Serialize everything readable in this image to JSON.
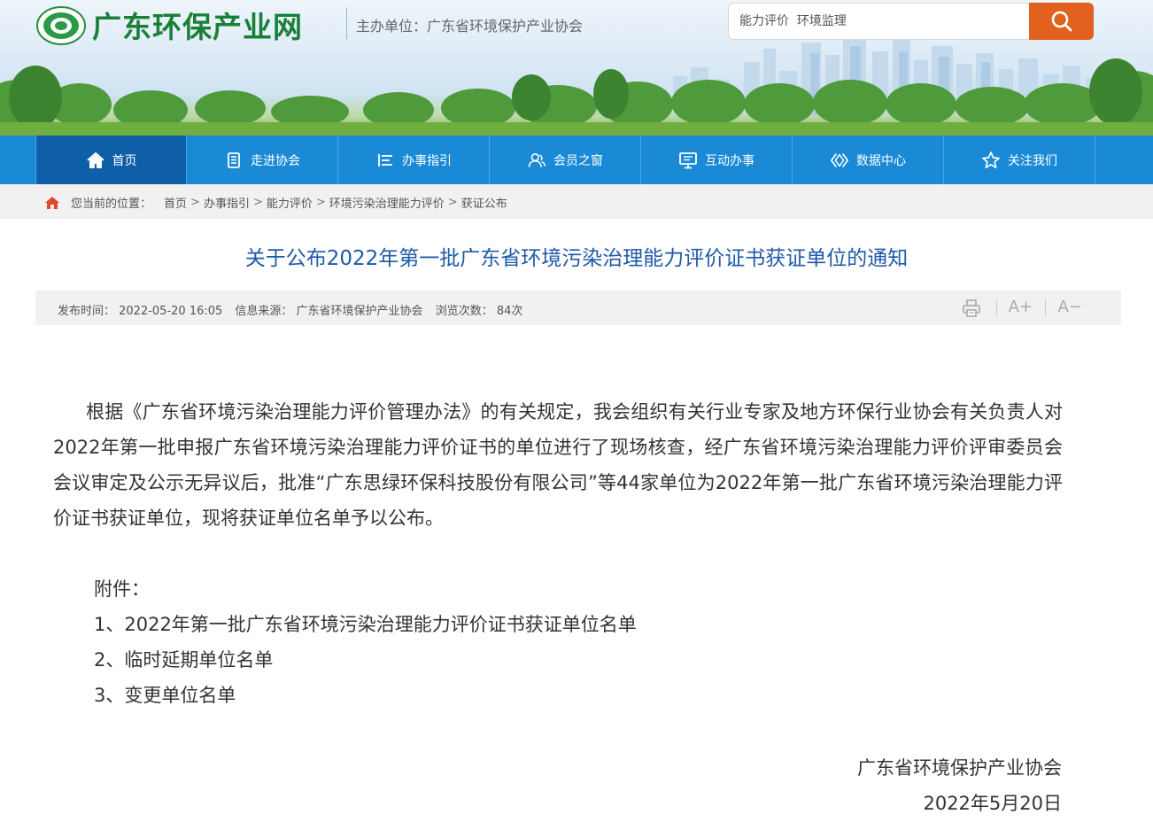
{
  "header": {
    "site_name": "广东环保产业网",
    "sponsor": "主办单位：广东省环境保护产业协会",
    "search_placeholder": "能力评价  环境监理"
  },
  "nav": {
    "items": [
      {
        "label": "首页",
        "icon": "home-icon",
        "active": true
      },
      {
        "label": "走进协会",
        "icon": "document-icon"
      },
      {
        "label": "办事指引",
        "icon": "list-icon"
      },
      {
        "label": "会员之窗",
        "icon": "members-icon"
      },
      {
        "label": "互动办事",
        "icon": "monitor-icon"
      },
      {
        "label": "数据中心",
        "icon": "data-icon"
      },
      {
        "label": "关注我们",
        "icon": "star-icon"
      }
    ]
  },
  "breadcrumb": {
    "lead": "您当前的位置：",
    "items": [
      "首页",
      "办事指引",
      "能力评价",
      "环境污染治理能力评价",
      "获证公布"
    ],
    "separator": ">"
  },
  "article": {
    "title": "关于公布2022年第一批广东省环境污染治理能力评价证书获证单位的通知",
    "meta": {
      "publish_time": "发布时间：  2022-05-20 16:05",
      "source": "信息来源：  广东省环境保护产业协会",
      "views": "浏览次数：  84次"
    },
    "tools": {
      "print_icon": "printer-icon",
      "font_up": "A+",
      "font_down": "A−"
    },
    "body": "根据《广东省环境污染治理能力评价管理办法》的有关规定，我会组织有关行业专家及地方环保行业协会有关负责人对2022年第一批申报广东省环境污染治理能力评价证书的单位进行了现场核查，经广东省环境污染治理能力评价评审委员会会议审定及公示无异议后，批准“广东思绿环保科技股份有限公司”等44家单位为2022年第一批广东省环境污染治理能力评价证书获证单位，现将获证单位名单予以公布。",
    "attachments_label": "附件：",
    "attachments": [
      "1、2022年第一批广东省环境污染治理能力评价证书获证单位名单",
      "2、临时延期单位名单",
      "3、变更单位名单"
    ],
    "signature": "广东省环境保护产业协会",
    "date": "2022年5月20日"
  },
  "colors": {
    "nav": "#1a8ad6",
    "nav_active": "#0e5fa8",
    "title": "#1f5aa8",
    "search_button": "#e2611e",
    "brand_green": "#1a7f37"
  }
}
